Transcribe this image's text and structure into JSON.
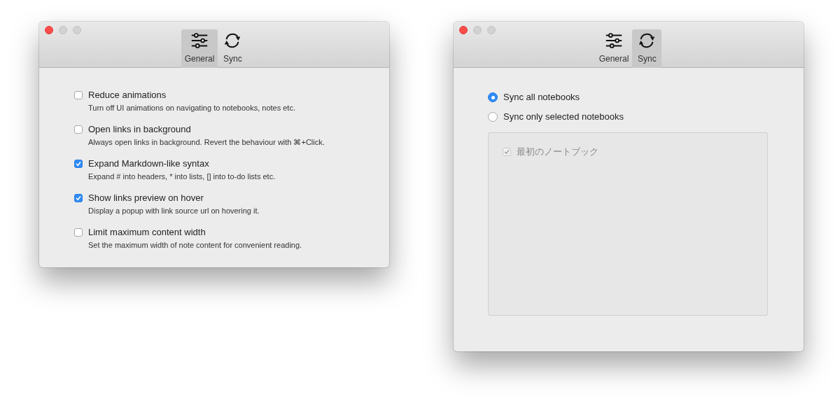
{
  "windows": [
    {
      "kind": "general",
      "tabs": [
        {
          "label": "General",
          "kind": "settings",
          "selected": true
        },
        {
          "label": "Sync",
          "kind": "sync",
          "selected": false
        }
      ],
      "options": [
        {
          "label": "Reduce animations",
          "description": "Turn off UI animations on navigating to notebooks, notes etc.",
          "checked": false
        },
        {
          "label": "Open links in background",
          "description": "Always open links in background. Revert the behaviour with ⌘+Click.",
          "checked": false
        },
        {
          "label": "Expand Markdown-like syntax",
          "description": "Expand # into headers, * into lists, [] into to-do lists etc.",
          "checked": true
        },
        {
          "label": "Show links preview on hover",
          "description": "Display a popup with link source url on hovering it.",
          "checked": true
        },
        {
          "label": "Limit maximum content width",
          "description": "Set the maximum width of note content for convenient reading.",
          "checked": false
        }
      ]
    },
    {
      "kind": "sync",
      "tabs": [
        {
          "label": "General",
          "kind": "settings",
          "selected": false
        },
        {
          "label": "Sync",
          "kind": "sync",
          "selected": true
        }
      ],
      "sync_modes": [
        {
          "label": "Sync all notebooks",
          "selected": true
        },
        {
          "label": "Sync only selected notebooks",
          "selected": false
        }
      ],
      "notebooks": [
        {
          "label": "最初のノートブック",
          "checked": true,
          "disabled": true
        }
      ]
    }
  ]
}
